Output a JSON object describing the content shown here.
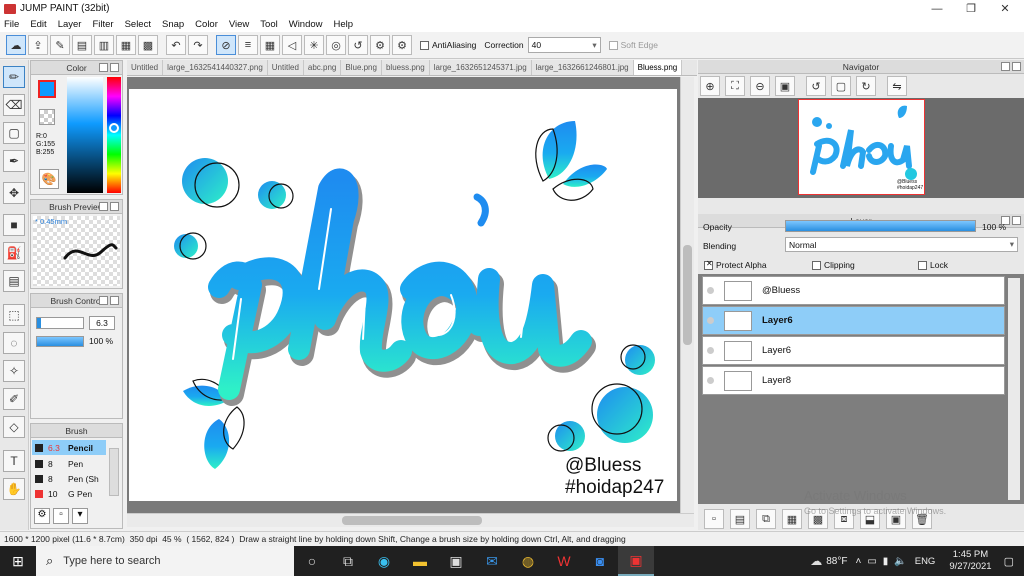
{
  "window": {
    "title": "JUMP PAINT (32bit)",
    "minimize": "—",
    "restore": "❐",
    "close": "✕"
  },
  "menu": [
    "File",
    "Edit",
    "Layer",
    "Filter",
    "Select",
    "Snap",
    "Color",
    "View",
    "Tool",
    "Window",
    "Help"
  ],
  "toolbar": {
    "antialiasing_label": "AntiAliasing",
    "correction_label": "Correction",
    "correction_value": "40",
    "softedge_label": "Soft Edge"
  },
  "color_panel": {
    "title": "Color",
    "r": "R:0",
    "g": "G:155",
    "b": "B:255",
    "fg_color": "#0f9bff",
    "bg_color": "#00e6b0"
  },
  "brush_preview": {
    "title": "Brush Preview",
    "size": "* 0.45mm"
  },
  "brush_control": {
    "title": "Brush Control",
    "size": "6.3",
    "opacity": "100 %"
  },
  "brush_panel": {
    "title": "Brush",
    "items": [
      {
        "size": "6.3",
        "name": "Pencil",
        "color": "#222"
      },
      {
        "size": "8",
        "name": "Pen",
        "color": "#222"
      },
      {
        "size": "8",
        "name": "Pen (Sh",
        "color": "#222"
      },
      {
        "size": "10",
        "name": "G Pen",
        "color": "#e33"
      }
    ]
  },
  "tabs": [
    "Untitled",
    "large_1632541440327.png",
    "Untitled",
    "abc.png",
    "Blue.png",
    "bluess.png",
    "large_1632651245371.jpg",
    "large_1632661246801.jpg",
    "Bluess.png"
  ],
  "artwork": {
    "word": "phou",
    "signature": "@Bluess",
    "hashtag": "#hoidap247"
  },
  "navigator": {
    "title": "Navigator",
    "thumb_signature": "@Bluess",
    "thumb_hashtag": "#hoidap247"
  },
  "layer_panel": {
    "title": "Layer",
    "opacity_label": "Opacity",
    "opacity_value": "100 %",
    "opacity_fraction": 1.0,
    "blending_label": "Blending",
    "blending_value": "Normal",
    "protect_alpha": "Protect Alpha",
    "clipping": "Clipping",
    "lock": "Lock",
    "layers": [
      "@Bluess",
      "Layer6",
      "Layer6",
      "Layer8"
    ],
    "selected_index": 1
  },
  "status": {
    "size": "1600 * 1200 pixel",
    "cm": "(11.6 * 8.7cm)",
    "dpi": "350 dpi",
    "zoom": "45 %",
    "coords": "( 1562, 824 )",
    "hint": "Draw a straight line by holding down Shift, Change a brush size by holding down Ctrl, Alt, and dragging"
  },
  "activate": {
    "line1": "Activate Windows",
    "line2": "Go to Settings to activate Windows."
  },
  "taskbar": {
    "search": "Type here to search",
    "weather": "88°F",
    "lang": "ENG",
    "time": "1:45 PM",
    "date": "9/27/2021"
  }
}
